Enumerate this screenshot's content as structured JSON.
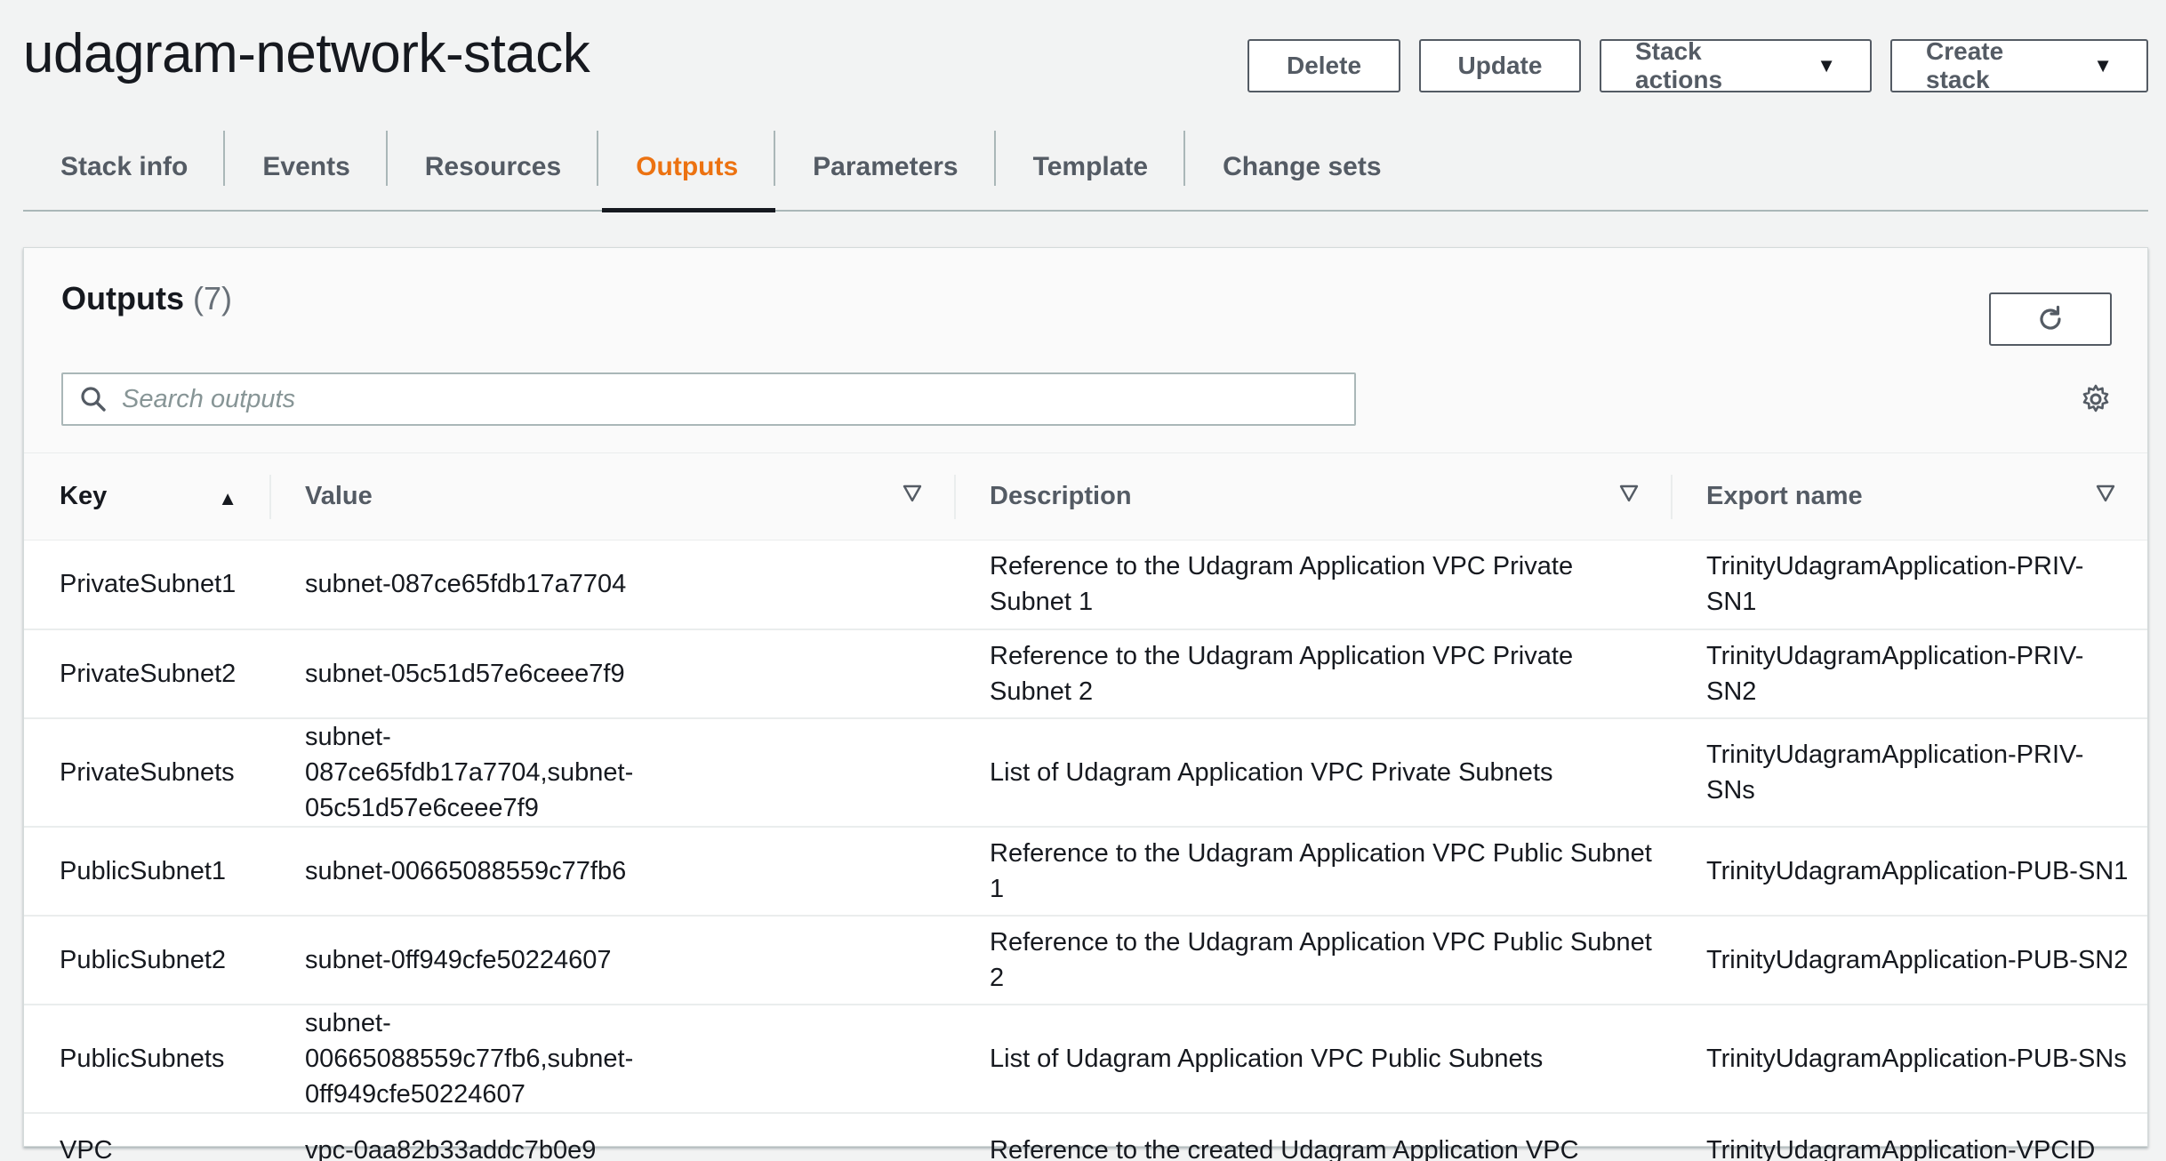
{
  "header": {
    "title": "udagram-network-stack",
    "delete_label": "Delete",
    "update_label": "Update",
    "stack_actions_label": "Stack actions",
    "create_stack_label": "Create stack"
  },
  "tabs": [
    {
      "label": "Stack info",
      "active": false
    },
    {
      "label": "Events",
      "active": false
    },
    {
      "label": "Resources",
      "active": false
    },
    {
      "label": "Outputs",
      "active": true
    },
    {
      "label": "Parameters",
      "active": false
    },
    {
      "label": "Template",
      "active": false
    },
    {
      "label": "Change sets",
      "active": false
    }
  ],
  "panel": {
    "title": "Outputs",
    "count": "(7)",
    "search_placeholder": "Search outputs",
    "search_value": ""
  },
  "table": {
    "columns": [
      "Key",
      "Value",
      "Description",
      "Export name"
    ],
    "sort_column": "Key",
    "sort_direction": "ascending",
    "rows": [
      {
        "key": "PrivateSubnet1",
        "value": "subnet-087ce65fdb17a7704",
        "description": "Reference to the Udagram Application VPC Private Subnet 1",
        "export": "TrinityUdagramApplication-PRIV-SN1"
      },
      {
        "key": "PrivateSubnet2",
        "value": "subnet-05c51d57e6ceee7f9",
        "description": "Reference to the Udagram Application VPC Private Subnet 2",
        "export": "TrinityUdagramApplication-PRIV-SN2"
      },
      {
        "key": "PrivateSubnets",
        "value": "subnet-087ce65fdb17a7704,subnet-05c51d57e6ceee7f9",
        "description": "List of Udagram Application VPC Private Subnets",
        "export": "TrinityUdagramApplication-PRIV-SNs"
      },
      {
        "key": "PublicSubnet1",
        "value": "subnet-00665088559c77fb6",
        "description": "Reference to the Udagram Application VPC Public Subnet 1",
        "export": "TrinityUdagramApplication-PUB-SN1"
      },
      {
        "key": "PublicSubnet2",
        "value": "subnet-0ff949cfe50224607",
        "description": "Reference to the Udagram Application VPC Public Subnet 2",
        "export": "TrinityUdagramApplication-PUB-SN2"
      },
      {
        "key": "PublicSubnets",
        "value": "subnet-00665088559c77fb6,subnet-0ff949cfe50224607",
        "description": "List of Udagram Application VPC Public Subnets",
        "export": "TrinityUdagramApplication-PUB-SNs"
      },
      {
        "key": "VPC",
        "value": "vpc-0aa82b33addc7b0e9",
        "description": "Reference to the created Udagram Application VPC",
        "export": "TrinityUdagramApplication-VPCID"
      }
    ]
  },
  "colors": {
    "accent_active_tab": "#ec7211",
    "text_primary": "#16191f",
    "text_secondary": "#545b64",
    "border": "#aab7b8",
    "background": "#f2f3f3"
  },
  "icons": {
    "search": "search-icon",
    "refresh": "refresh-icon",
    "settings": "gear-icon",
    "sort": "sort-ascending-icon",
    "filter": "filter-icon",
    "dropdown": "caret-down-icon"
  }
}
